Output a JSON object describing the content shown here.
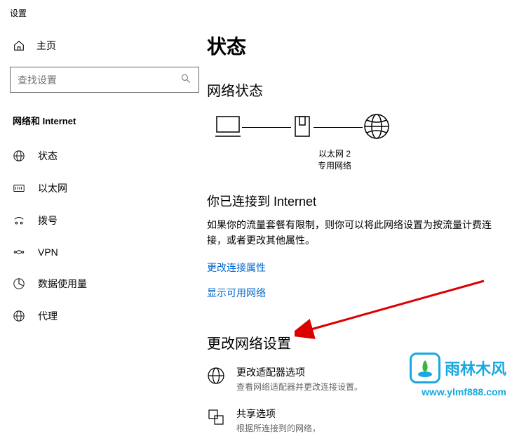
{
  "window": {
    "title": "设置"
  },
  "sidebar": {
    "home": "主页",
    "search_placeholder": "查找设置",
    "category": "网络和 Internet",
    "items": [
      {
        "label": "状态"
      },
      {
        "label": "以太网"
      },
      {
        "label": "拨号"
      },
      {
        "label": "VPN"
      },
      {
        "label": "数据使用量"
      },
      {
        "label": "代理"
      }
    ]
  },
  "main": {
    "title": "状态",
    "network_status_header": "网络状态",
    "diagram": {
      "adapter": "以太网 2",
      "network_type": "专用网络"
    },
    "connected_header": "你已连接到 Internet",
    "connected_body": "如果你的流量套餐有限制，则你可以将此网络设置为按流量计费连接，或者更改其他属性。",
    "link_change_conn": "更改连接属性",
    "link_show_networks": "显示可用网络",
    "change_settings_header": "更改网络设置",
    "options": [
      {
        "title": "更改适配器选项",
        "desc": "查看网络适配器并更改连接设置。"
      },
      {
        "title": "共享选项",
        "desc": "根据所连接到的网络，"
      }
    ]
  },
  "watermark": {
    "brand": "雨林木风",
    "url": "www.ylmf888.com"
  }
}
